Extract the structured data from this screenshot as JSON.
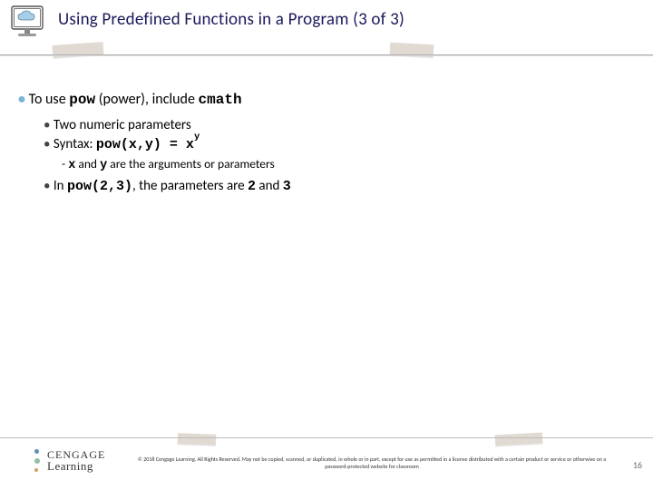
{
  "header": {
    "title": "Using Predefined Functions in a Program (3 of 3)"
  },
  "content": {
    "line1_a": "To use ",
    "line1_pow": "pow",
    "line1_b": " (power), include ",
    "line1_cmath": "cmath",
    "b2_a": "Two numeric parameters",
    "b2_b_pre": "Syntax: ",
    "b2_b_code": "pow(x,y) = x",
    "b2_b_sup": "y",
    "dash_a_pre": "- ",
    "dash_a_x": "x",
    "dash_a_mid": " and ",
    "dash_a_y": "y",
    "dash_a_post": " are the arguments or parameters",
    "b2_c_pre": "In ",
    "b2_c_code": "pow(2,3)",
    "b2_c_post": ", the parameters are ",
    "b2_c_two": "2",
    "b2_c_and": " and ",
    "b2_c_three": "3"
  },
  "footer": {
    "logo1": "CENGAGE",
    "logo2": "Learning",
    "copyright": "© 2018 Cengage Learning. All Rights Reserved. May not be copied, scanned, or duplicated, in whole or in part, except for use as permitted in a license distributed with a certain product or service or otherwise on a password-protected website for classroom",
    "page": "16"
  }
}
